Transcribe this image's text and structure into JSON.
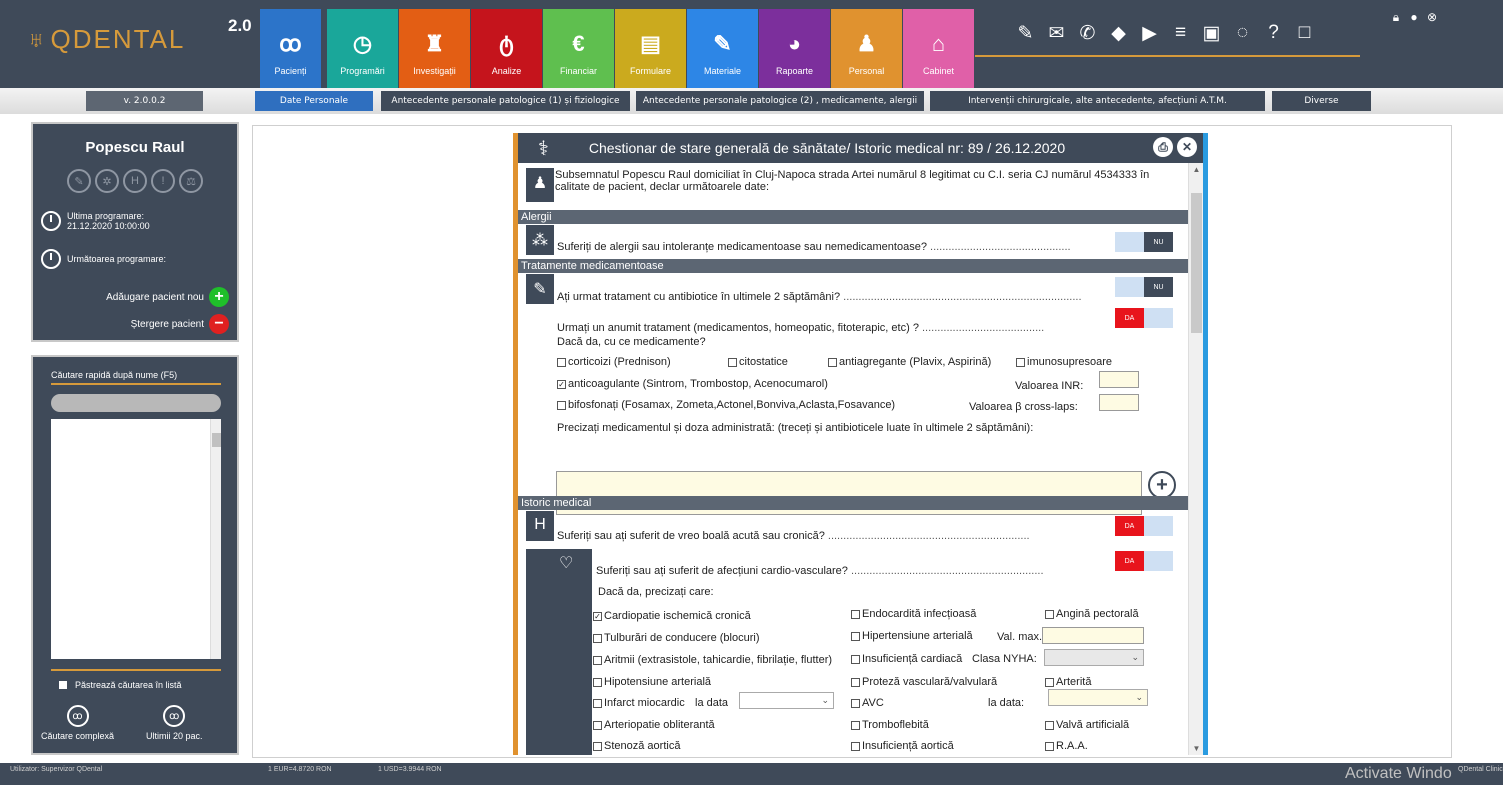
{
  "app": {
    "logo": "QDENTAL",
    "version_badge": "2.0",
    "version_tab": "v. 2.0.0.2"
  },
  "modules": [
    {
      "label": "Pacienți",
      "color": "#2c74c9",
      "icon": "patients-icon",
      "glyph": "ꝏ"
    },
    {
      "label": "Programări",
      "color": "#1aa79a",
      "icon": "clock-icon",
      "glyph": "◷"
    },
    {
      "label": "Investigații",
      "color": "#e35e14",
      "icon": "tooth-icon",
      "glyph": "♜"
    },
    {
      "label": "Analize",
      "color": "#c5141c",
      "icon": "flask-icon",
      "glyph": "ტ"
    },
    {
      "label": "Financiar",
      "color": "#5fbf4f",
      "icon": "euro-icon",
      "glyph": "€"
    },
    {
      "label": "Formulare",
      "color": "#cbaa1e",
      "icon": "document-icon",
      "glyph": "▤"
    },
    {
      "label": "Materiale",
      "color": "#2d86e6",
      "icon": "syringe-icon",
      "glyph": "✎"
    },
    {
      "label": "Rapoarte",
      "color": "#7c2f9c",
      "icon": "pie-chart-icon",
      "glyph": "◕"
    },
    {
      "label": "Personal",
      "color": "#e0922f",
      "icon": "person-icon",
      "glyph": "♟"
    },
    {
      "label": "Cabinet",
      "color": "#e060a8",
      "icon": "home-icon",
      "glyph": "⌂"
    }
  ],
  "toolbar_icons": [
    {
      "name": "pill-icon",
      "glyph": "✎"
    },
    {
      "name": "mail-icon",
      "glyph": "✉"
    },
    {
      "name": "sms-icon",
      "glyph": "✆"
    },
    {
      "name": "tag-icon",
      "glyph": "◆"
    },
    {
      "name": "play-icon",
      "glyph": "▶"
    },
    {
      "name": "database-icon",
      "glyph": "≡"
    },
    {
      "name": "save-icon",
      "glyph": "▣"
    },
    {
      "name": "chat-icon",
      "glyph": "◌"
    },
    {
      "name": "help-icon",
      "glyph": "?"
    },
    {
      "name": "calendar-icon",
      "glyph": "□"
    }
  ],
  "tabs": [
    "Date Personale",
    "Antecedente personale patologice (1) și fiziologice",
    "Antecedente personale patologice (2) , medicamente, alergii",
    "Intervenții chirurgicale, alte antecedente, afecțiuni A.T.M.",
    "Diverse"
  ],
  "patient": {
    "name": "Popescu Raul",
    "last_label": "Ultima programare:",
    "last_value": "21.12.2020 10:00:00",
    "next_label": "Următoarea programare:",
    "add_label": "Adăugare pacient nou",
    "delete_label": "Ștergere pacient"
  },
  "search": {
    "label": "Căutare rapidă după nume (F5)",
    "keep_label": "Păstrează căutarea în listă",
    "complex_label": "Căutare complexă",
    "last20_label": "Ultimii 20 pac."
  },
  "form": {
    "title": "Chestionar de stare generală de sănătate/ Istoric medical nr: 89 / 26.12.2020",
    "intro_1": "Subsemnatul Popescu Raul domiciliat în Cluj-Napoca strada Artei numărul 8 legitimat cu C.I. seria CJ numărul 4534333 în",
    "intro_2": "calitate de pacient, declar următoarele date:",
    "sec_allergies": "Alergii",
    "q_allergies": "Suferiți de alergii sau intoleranțe medicamentoase sau nemedicamentoase?",
    "sec_treatments": "Tratamente medicamentoase",
    "q_antibiotics": "Ați urmat tratament cu antibiotice în ultimele 2 săptămâni?",
    "q_treatment": "Urmați un anumit tratament (medicamentos, homeopatic, fitoterapic, etc) ?",
    "q_which_meds": "Dacă da, cu ce medicamente?",
    "cb_corticoizi": "corticoizi (Prednison)",
    "cb_citostatice": "citostatice",
    "cb_antiagregante": "antiagregante (Plavix, Aspirină)",
    "cb_imunosupresoare": "imunosupresoare",
    "cb_anticoagulante": "anticoagulante (Sintrom, Trombostop, Acenocumarol)",
    "inr_label": "Valoarea INR:",
    "cb_bifosfonati": "bifosfonați (Fosamax, Zometa,Actonel,Bonviva,Aclasta,Fosavance)",
    "beta_label": "Valoarea β cross-laps:",
    "precizati": "Precizați medicamentul și doza administrată: (treceți și antibioticele luate în ultimele 2 săptămâni):",
    "sec_history": "Istoric medical",
    "q_acute": "Suferiți sau ați suferit de vreo boală acută sau cronică?",
    "q_cardio": "Suferiți sau ați suferit de afecțiuni cardio-vasculare?",
    "q_specify": "Dacă da, precizați care:",
    "c1": [
      "Cardiopatie ischemică cronică",
      "Tulburări de conducere (blocuri)",
      "Aritmii (extrasistole, tahicardie, fibrilație, flutter)",
      "Hipotensiune arterială",
      "Infarct miocardic",
      "Arteriopatie obliterantă",
      "Stenoză aortică"
    ],
    "c2": [
      "Endocardită infecțioasă",
      "Hipertensiune arterială",
      "Insuficiență cardiacă",
      "Proteză vasculară/valvulară",
      "AVC",
      "Tromboflebită",
      "Insuficiență aortică"
    ],
    "c3": [
      "Angină pectorală",
      "Arterită",
      "Valvă artificială",
      "R.A.A."
    ],
    "val_max": "Val. max.",
    "clasa_nyha": "Clasa NYHA:",
    "la_data": "la data",
    "la_data2": "la data:",
    "nu": "NU",
    "da": "DA"
  },
  "statusbar": {
    "user": "Utilizator: Supervizor QDental",
    "eur": "1 EUR=4.8720 RON",
    "usd": "1 USD=3.9944 RON",
    "right": "QDental Clinic"
  },
  "watermark": "Activate Windo"
}
